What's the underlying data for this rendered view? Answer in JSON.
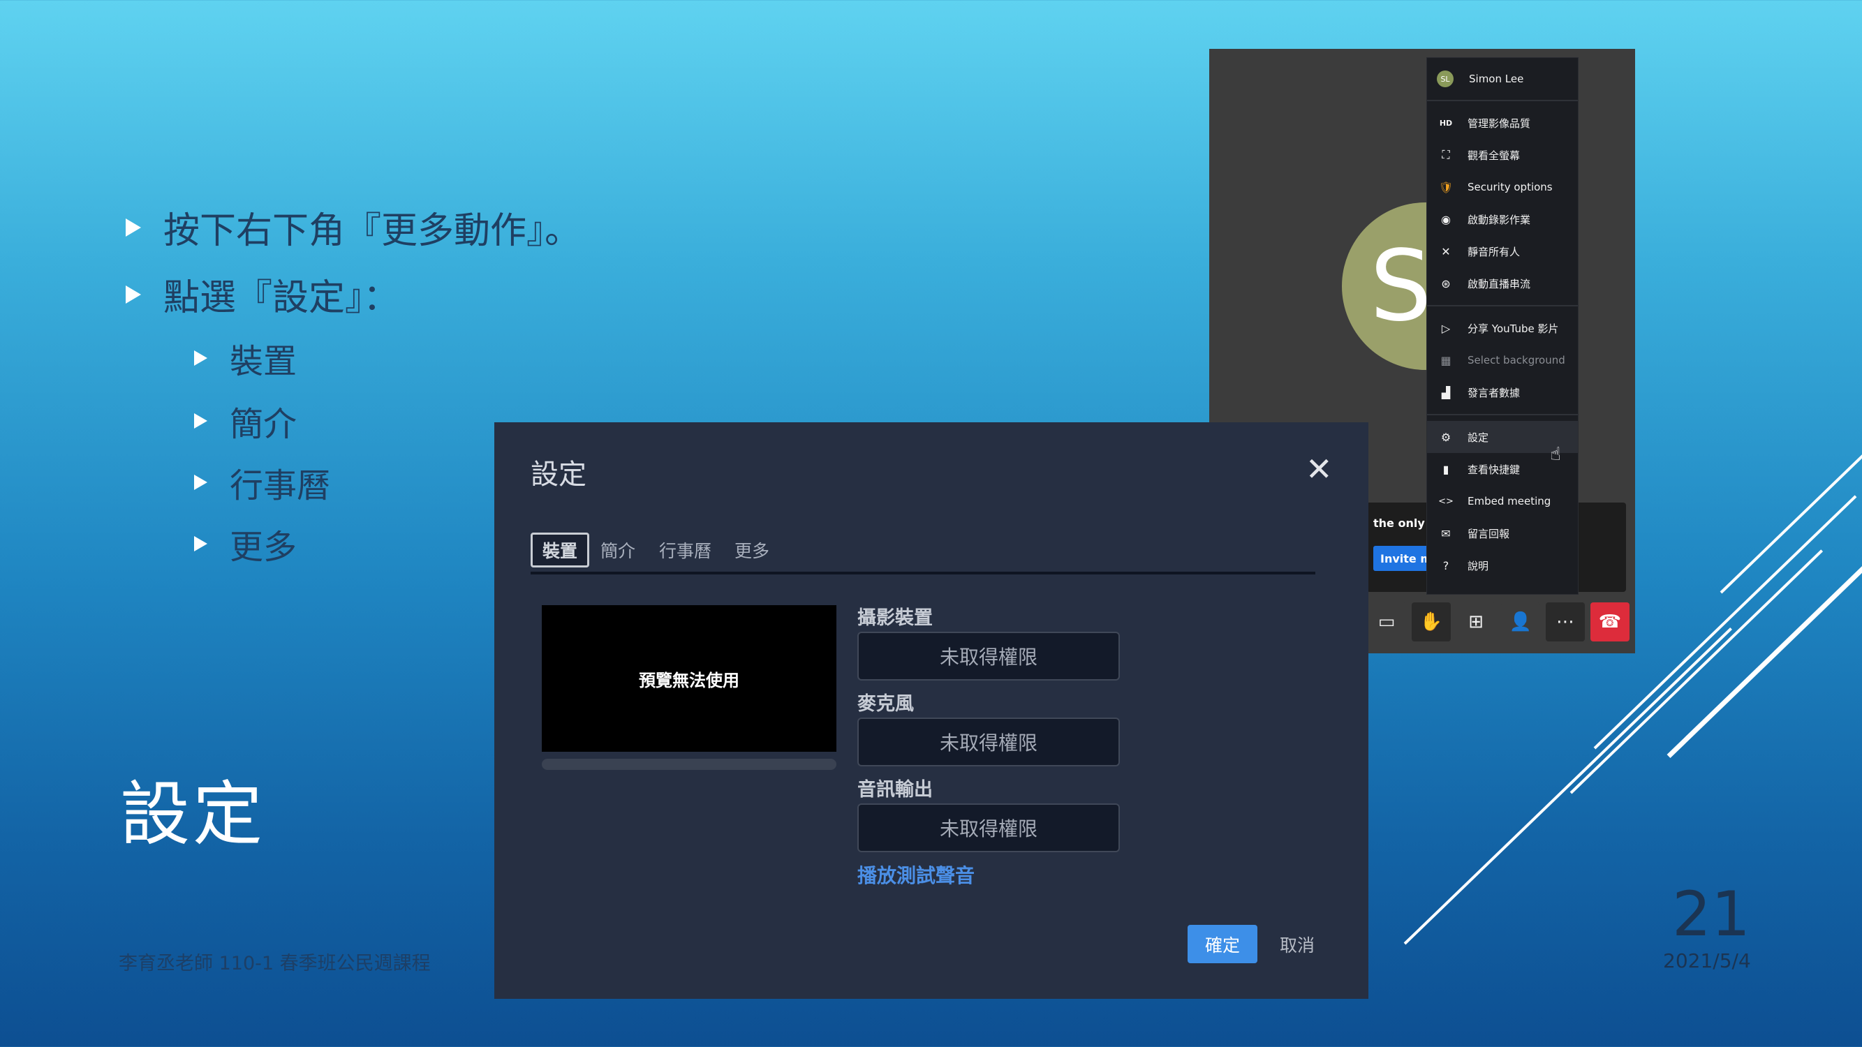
{
  "slide": {
    "bullets": [
      "按下右下角『更多動作』。",
      "點選『設定』："
    ],
    "sub_bullets": [
      "裝置",
      "簡介",
      "行事曆",
      "更多"
    ],
    "title": "設定",
    "footer_left": "李育丞老師 110-1 春季班公民週課程",
    "page_number": "21",
    "date": "2021/5/4"
  },
  "meeting": {
    "avatar_letter": "S",
    "notice_text": "the only o",
    "invite_label": "Invite m",
    "menu": {
      "user_initials": "SL",
      "user_name": "Simon Lee",
      "group1": [
        {
          "icon": "hd-icon",
          "glyph": "HD",
          "label": "管理影像品質"
        },
        {
          "icon": "fullscreen-icon",
          "glyph": "⛶",
          "label": "觀看全螢幕"
        },
        {
          "icon": "shield-icon",
          "glyph": "🛡",
          "label": "Security options"
        },
        {
          "icon": "record-icon",
          "glyph": "◉",
          "label": "啟動錄影作業"
        },
        {
          "icon": "mute-all-icon",
          "glyph": "✕",
          "label": "靜音所有人"
        },
        {
          "icon": "livestream-icon",
          "glyph": "⊛",
          "label": "啟動直播串流"
        }
      ],
      "group2": [
        {
          "icon": "youtube-play-icon",
          "glyph": "▷",
          "label": "分享 YouTube 影片"
        },
        {
          "icon": "background-icon",
          "glyph": "▦",
          "label": "Select background",
          "muted": true
        },
        {
          "icon": "speaker-stats-icon",
          "glyph": "▟",
          "label": "發言者數據"
        }
      ],
      "group3": [
        {
          "icon": "gear-icon",
          "glyph": "⚙",
          "label": "設定"
        },
        {
          "icon": "document-icon",
          "glyph": "▮",
          "label": "查看快捷鍵"
        },
        {
          "icon": "code-icon",
          "glyph": "<>",
          "label": "Embed meeting"
        },
        {
          "icon": "feedback-icon",
          "glyph": "✉",
          "label": "留言回報"
        },
        {
          "icon": "help-icon",
          "glyph": "?",
          "label": "說明"
        }
      ]
    },
    "toolbar": [
      {
        "name": "chat-icon",
        "glyph": "▭"
      },
      {
        "name": "raise-hand-icon",
        "glyph": "✋"
      },
      {
        "name": "tile-view-icon",
        "glyph": "⊞"
      },
      {
        "name": "invite-icon",
        "glyph": "👤"
      },
      {
        "name": "more-actions-icon",
        "glyph": "⋯"
      },
      {
        "name": "hangup-icon",
        "glyph": "☎"
      }
    ]
  },
  "settings_dialog": {
    "title": "設定",
    "close_glyph": "✕",
    "tabs": [
      "裝置",
      "簡介",
      "行事曆",
      "更多"
    ],
    "preview_text": "預覽無法使用",
    "camera_label": "攝影裝置",
    "camera_value": "未取得權限",
    "mic_label": "麥克風",
    "mic_value": "未取得權限",
    "audio_out_label": "音訊輸出",
    "audio_out_value": "未取得權限",
    "test_sound": "播放測試聲音",
    "ok_label": "確定",
    "cancel_label": "取消"
  }
}
